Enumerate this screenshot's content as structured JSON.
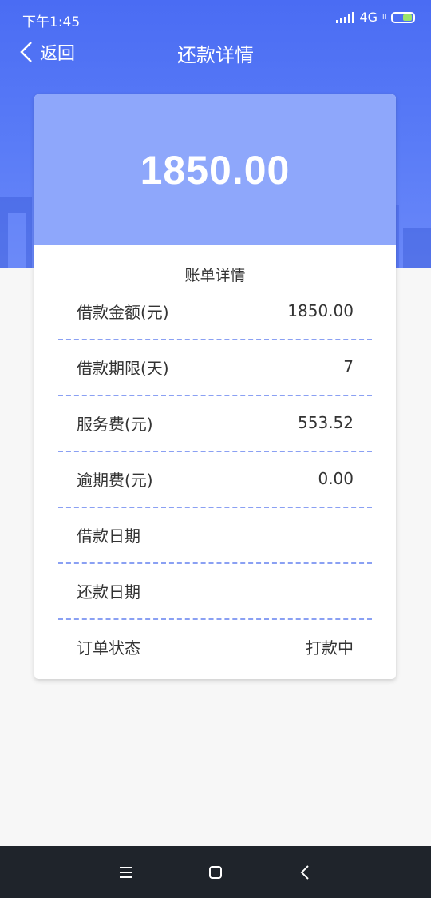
{
  "status_bar": {
    "time": "下午1:45",
    "network": "4G",
    "network_sub": "ll"
  },
  "nav": {
    "back_label": "返回",
    "title": "还款详情"
  },
  "summary": {
    "amount": "1850.00"
  },
  "bill": {
    "title": "账单详情",
    "rows": [
      {
        "label": "借款金额(元)",
        "value": "1850.00"
      },
      {
        "label": "借款期限(天)",
        "value": "7"
      },
      {
        "label": "服务费(元)",
        "value": "553.52"
      },
      {
        "label": "逾期费(元)",
        "value": "0.00"
      },
      {
        "label": "借款日期",
        "value": ""
      },
      {
        "label": "还款日期",
        "value": ""
      },
      {
        "label": "订单状态",
        "value": "打款中"
      }
    ]
  },
  "colors": {
    "header_blue": "#4a6cf3",
    "amount_panel": "#8ea7fb",
    "divider": "#8aa0f3",
    "battery_fill": "#9be36a"
  },
  "icons": {
    "back": "chevron-left-icon",
    "menu": "menu-icon",
    "home": "square-icon",
    "system_back": "chevron-left-icon"
  }
}
